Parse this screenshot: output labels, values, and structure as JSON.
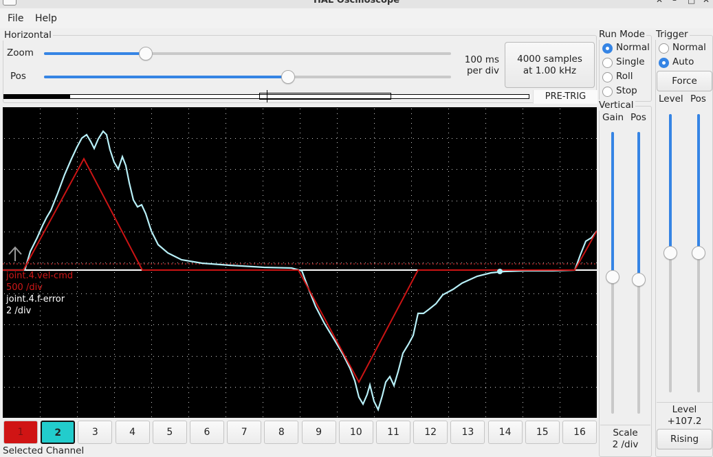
{
  "window": {
    "title": "HAL Oscilloscope"
  },
  "menu": {
    "file": "File",
    "help": "Help"
  },
  "horizontal": {
    "label": "Horizontal",
    "zoom_label": "Zoom",
    "pos_label": "Pos",
    "zoom_value": 0.25,
    "pos_value": 0.6,
    "per_div_line1": "100 ms",
    "per_div_line2": "per div",
    "samples_line1": "4000 samples",
    "samples_line2": "at 1.00 kHz",
    "pre_trig": "PRE-TRIG"
  },
  "run_mode": {
    "label": "Run Mode",
    "options": [
      "Normal",
      "Single",
      "Roll",
      "Stop"
    ],
    "selected": "Normal"
  },
  "trigger": {
    "label": "Trigger",
    "options": [
      "Normal",
      "Auto"
    ],
    "selected": "Auto",
    "force": "Force",
    "level_label": "Level",
    "pos_label": "Pos",
    "level_value_label": "Level",
    "level_value": "+107.2",
    "edge": "Rising"
  },
  "vertical": {
    "label": "Vertical",
    "gain_label": "Gain",
    "pos_label": "Pos",
    "scale_label": "Scale",
    "scale_value": "2 /div"
  },
  "scope": {
    "background": "#000000",
    "grid_color": "#d0d0d0",
    "channels_info": [
      {
        "name": "joint.4.vel-cmd",
        "scale": "500 /div",
        "color": "#d01818"
      },
      {
        "name": "joint.4.f-error",
        "scale": "2 /div",
        "color": "#ffffff"
      }
    ],
    "trace_colors": {
      "cmd": "#cc1414",
      "err": "#b8f0f8"
    }
  },
  "channel_buttons": {
    "labels": [
      "1",
      "2",
      "3",
      "4",
      "5",
      "6",
      "7",
      "8",
      "9",
      "10",
      "11",
      "12",
      "13",
      "14",
      "15",
      "16"
    ],
    "active_colors": {
      "1": "#d01414",
      "2": "#22cccc"
    }
  },
  "selected_channel_label": "Selected Channel"
}
